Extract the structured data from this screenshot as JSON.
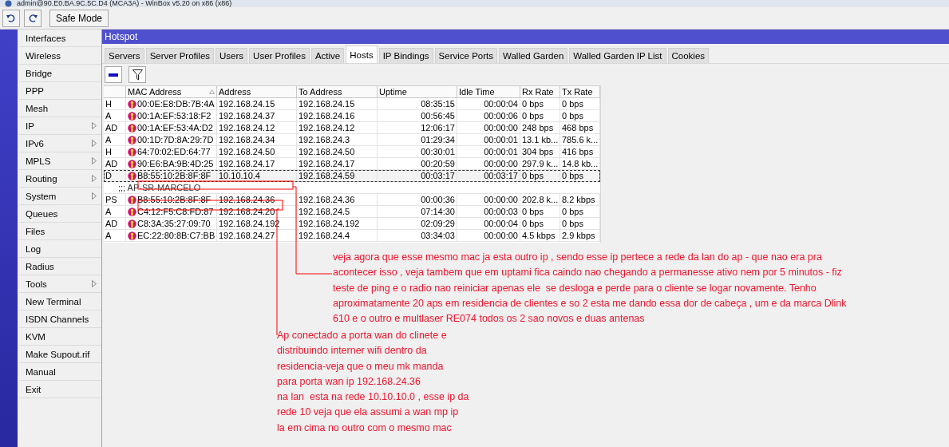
{
  "window": {
    "title": "admin@90.E0.BA.9C.5C.D4 (MCA3A) - WinBox v5.20 on x86 (x86)"
  },
  "toolbar": {
    "buttons": [
      {
        "kind": "undo"
      },
      {
        "kind": "redo"
      },
      {
        "kind": "text",
        "label": "Safe Mode"
      }
    ]
  },
  "sidebar": {
    "items": [
      {
        "label": "Interfaces",
        "submenu": false
      },
      {
        "label": "Wireless",
        "submenu": false
      },
      {
        "label": "Bridge",
        "submenu": false
      },
      {
        "label": "PPP",
        "submenu": false
      },
      {
        "label": "Mesh",
        "submenu": false
      },
      {
        "label": "IP",
        "submenu": true
      },
      {
        "label": "IPv6",
        "submenu": true
      },
      {
        "label": "MPLS",
        "submenu": true
      },
      {
        "label": "Routing",
        "submenu": true
      },
      {
        "label": "System",
        "submenu": true
      },
      {
        "label": "Queues",
        "submenu": false
      },
      {
        "label": "Files",
        "submenu": false
      },
      {
        "label": "Log",
        "submenu": false
      },
      {
        "label": "Radius",
        "submenu": false
      },
      {
        "label": "Tools",
        "submenu": true
      },
      {
        "label": "New Terminal",
        "submenu": false
      },
      {
        "label": "ISDN Channels",
        "submenu": false
      },
      {
        "label": "KVM",
        "submenu": false
      },
      {
        "label": "Make Supout.rif",
        "submenu": false
      },
      {
        "label": "Manual",
        "submenu": false
      },
      {
        "label": "Exit",
        "submenu": false
      }
    ]
  },
  "hotspot": {
    "title": "Hotspot",
    "tabs": [
      {
        "label": "Servers",
        "selected": false
      },
      {
        "label": "Server Profiles",
        "selected": false
      },
      {
        "label": "Users",
        "selected": false
      },
      {
        "label": "User Profiles",
        "selected": false
      },
      {
        "label": "Active",
        "selected": false
      },
      {
        "label": "Hosts",
        "selected": true
      },
      {
        "label": "IP Bindings",
        "selected": false
      },
      {
        "label": "Service Ports",
        "selected": false
      },
      {
        "label": "Walled Garden",
        "selected": false
      },
      {
        "label": "Walled Garden IP List",
        "selected": false
      },
      {
        "label": "Cookies",
        "selected": false
      }
    ],
    "actions": [
      {
        "kind": "remove"
      },
      {
        "kind": "filter"
      }
    ],
    "table": {
      "columns": [
        {
          "sorted": false
        },
        {
          "label": "MAC Address",
          "sorted": true
        },
        {
          "label": "Address",
          "sorted": false
        },
        {
          "label": "To Address",
          "sorted": false
        },
        {
          "label": "Uptime",
          "sorted": false
        },
        {
          "label": "Idle Time",
          "sorted": false
        },
        {
          "label": "Rx Rate",
          "sorted": false
        },
        {
          "label": "Tx Rate",
          "sorted": false
        }
      ],
      "rows": [
        {
          "kind": "host",
          "selected": false,
          "cells": [
            "H",
            "00:0E:E8:DB:7B:4A",
            "192.168.24.15",
            "192.168.24.15",
            "08:35:15",
            "00:00:04",
            "0 bps",
            "0 bps"
          ]
        },
        {
          "kind": "host",
          "selected": false,
          "cells": [
            "A",
            "00:1A:EF:53:18:F2",
            "192.168.24.37",
            "192.168.24.16",
            "00:56:45",
            "00:00:06",
            "0 bps",
            "0 bps"
          ]
        },
        {
          "kind": "host",
          "selected": false,
          "cells": [
            "AD",
            "00:1A:EF:53:4A:D2",
            "192.168.24.12",
            "192.168.24.12",
            "12:06:17",
            "00:00:00",
            "248 bps",
            "468 bps"
          ]
        },
        {
          "kind": "host",
          "selected": false,
          "cells": [
            "A",
            "00:1D:7D:8A:29:7D",
            "192.168.24.34",
            "192.168.24.3",
            "01:29:34",
            "00:00:01",
            "13.1 kb...",
            "785.6 k..."
          ]
        },
        {
          "kind": "host",
          "selected": false,
          "cells": [
            "H",
            "64:70:02:ED:64:77",
            "192.168.24.50",
            "192.168.24.50",
            "00:30:01",
            "00:00:01",
            "304 bps",
            "416 bps"
          ]
        },
        {
          "kind": "host",
          "selected": false,
          "cells": [
            "AD",
            "90:E6:BA:9B:4D:25",
            "192.168.24.17",
            "192.168.24.17",
            "00:20:59",
            "00:00:00",
            "297.9 k...",
            "14.8 kb..."
          ]
        },
        {
          "kind": "host",
          "selected": true,
          "cells": [
            "D",
            "B8:55:10:2B:8F:8F",
            "10.10.10.4",
            "192.168.24.59",
            "00:03:17",
            "00:03:17",
            "0 bps",
            "0 bps"
          ]
        },
        {
          "kind": "comment",
          "selected": false,
          "text": ";;; AP-SR-MARCELO"
        },
        {
          "kind": "host",
          "selected": false,
          "cells": [
            "PS",
            "B8:55:10:2B:8F:8F",
            "192.168.24.36",
            "192.168.24.36",
            "00:00:36",
            "00:00:00",
            "202.8 k...",
            "8.2 kbps"
          ]
        },
        {
          "kind": "host",
          "selected": false,
          "cells": [
            "A",
            "C4:12:F5:C8:FD:87",
            "192.168.24.20",
            "192.168.24.5",
            "07:14:30",
            "00:00:03",
            "0 bps",
            "0 bps"
          ]
        },
        {
          "kind": "host",
          "selected": false,
          "cells": [
            "AD",
            "C8:3A:35:27:09:70",
            "192.168.24.192",
            "192.168.24.192",
            "02:09:29",
            "00:00:04",
            "0 bps",
            "0 bps"
          ]
        },
        {
          "kind": "host",
          "selected": false,
          "cells": [
            "A",
            "EC:22:80:8B:C7:BB",
            "192.168.24.27",
            "192.168.24.4",
            "03:34:03",
            "00:00:00",
            "4.5 kbps",
            "2.9 kbps"
          ]
        }
      ]
    }
  },
  "annotations": [
    {
      "text": "veja agora que esse mesmo mac ja esta outro ip , sendo esse ip pertece a rede da lan do ap - que nao era pra\nacontecer isso , veja tambem que em uptami fica caindo nao chegando a permanesse ativo nem por 5 minutos - fiz\nteste de ping e o radio nao reiniciar apenas ele  se desloga e perde para o cliente se logar novamente. Tenho\naproximatamente 20 aps em residencia de clientes e so 2 esta me dando essa dor de cabeça , um e da marca Dlink\n610 e o outro e multlaser RE074 todos os 2 sao novos e duas antenas"
    },
    {
      "text": "Ap conectado a porta wan do clinete e\ndistribuindo interner wifi dentro da\nresidencia-veja que o meu mk manda\npara porta wan ip 192.168.24.36\nna lan  esta na rede 10.10.10.0 , esse ip da\nrede 10 veja que ela assumi a wan mp ip\nla em cima no outro com o mesmo mac"
    }
  ]
}
